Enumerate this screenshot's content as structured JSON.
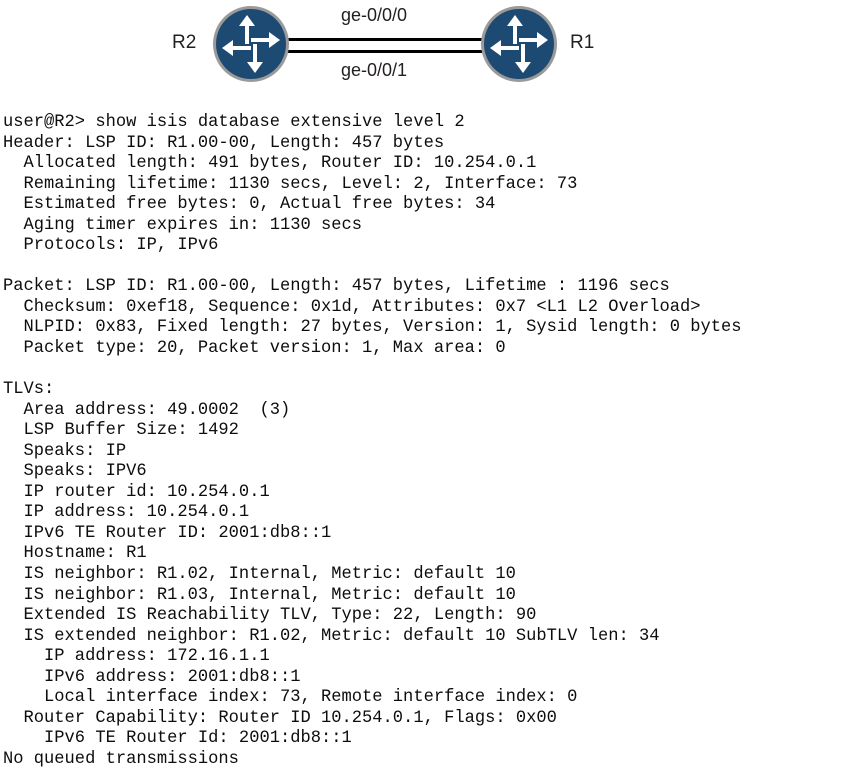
{
  "topology": {
    "left_router": {
      "label": "R2",
      "icon": "router-icon"
    },
    "right_router": {
      "label": "R1",
      "icon": "router-icon"
    },
    "links": [
      {
        "label": "ge-0/0/0"
      },
      {
        "label": "ge-0/0/1"
      }
    ],
    "colors": {
      "router_fill": "#1d4a73",
      "router_ring": "#9a9a9a",
      "arrow": "#ffffff",
      "link": "#000000",
      "label_text": "#231f20"
    }
  },
  "terminal": {
    "prompt": "user@R2>",
    "command": "show isis database extensive level 2",
    "lines": [
      "user@R2> show isis database extensive level 2",
      "Header: LSP ID: R1.00-00, Length: 457 bytes",
      "  Allocated length: 491 bytes, Router ID: 10.254.0.1",
      "  Remaining lifetime: 1130 secs, Level: 2, Interface: 73",
      "  Estimated free bytes: 0, Actual free bytes: 34",
      "  Aging timer expires in: 1130 secs",
      "  Protocols: IP, IPv6",
      "",
      "Packet: LSP ID: R1.00-00, Length: 457 bytes, Lifetime : 1196 secs",
      "  Checksum: 0xef18, Sequence: 0x1d, Attributes: 0x7 <L1 L2 Overload>",
      "  NLPID: 0x83, Fixed length: 27 bytes, Version: 1, Sysid length: 0 bytes",
      "  Packet type: 20, Packet version: 1, Max area: 0",
      "",
      "TLVs:",
      "  Area address: 49.0002  (3)",
      "  LSP Buffer Size: 1492",
      "  Speaks: IP",
      "  Speaks: IPV6",
      "  IP router id: 10.254.0.1",
      "  IP address: 10.254.0.1",
      "  IPv6 TE Router ID: 2001:db8::1",
      "  Hostname: R1",
      "  IS neighbor: R1.02, Internal, Metric: default 10",
      "  IS neighbor: R1.03, Internal, Metric: default 10",
      "  Extended IS Reachability TLV, Type: 22, Length: 90",
      "  IS extended neighbor: R1.02, Metric: default 10 SubTLV len: 34",
      "    IP address: 172.16.1.1",
      "    IPv6 address: 2001:db8::1",
      "    Local interface index: 73, Remote interface index: 0",
      "  Router Capability: Router ID 10.254.0.1, Flags: 0x00",
      "    IPv6 TE Router Id: 2001:db8::1",
      "No queued transmissions"
    ]
  }
}
